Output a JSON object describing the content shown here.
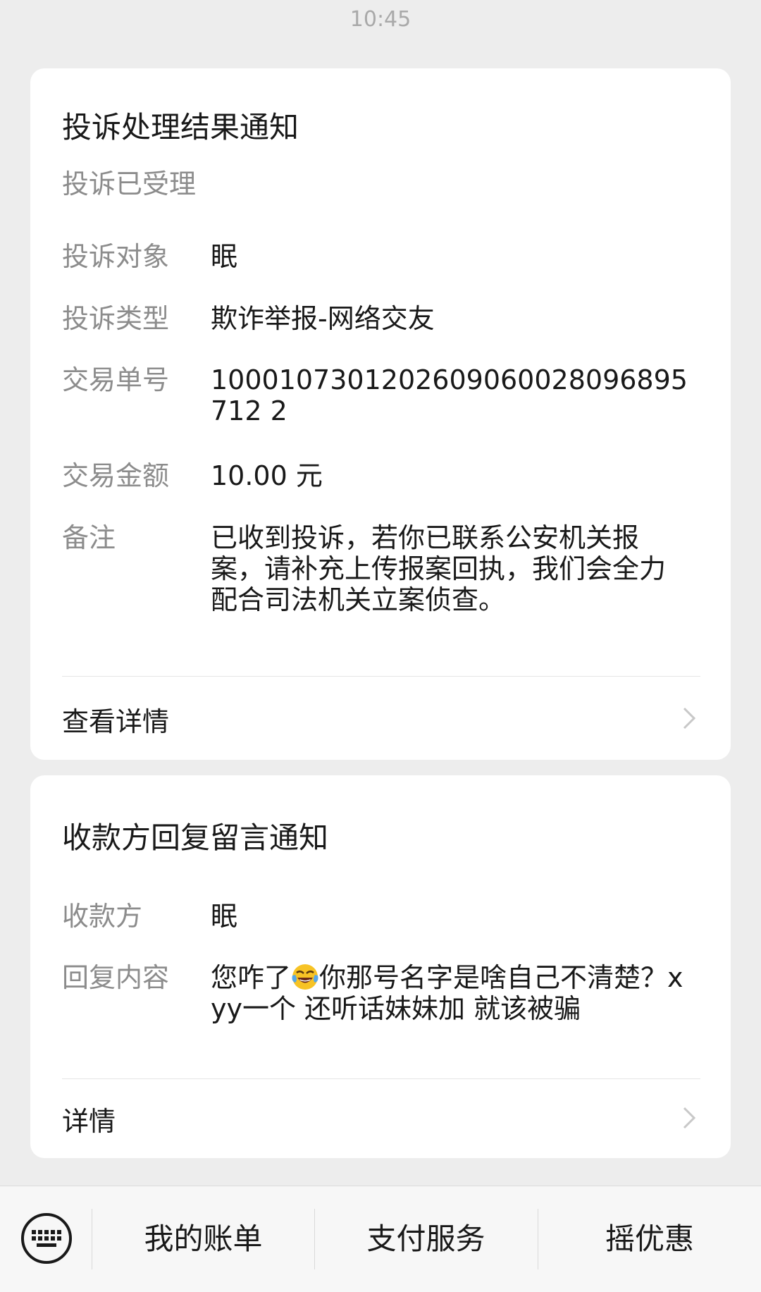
{
  "timestamp": "10:45",
  "complaint_card": {
    "title": "投诉处理结果通知",
    "subtitle": "投诉已受理",
    "rows": [
      {
        "label": "投诉对象",
        "value": "眠"
      },
      {
        "label": "投诉类型",
        "value": "欺诈举报-网络交友"
      },
      {
        "label": "交易单号",
        "value": "1000107301202609060028096895712 2"
      },
      {
        "label": "交易金额",
        "value": "10.00 元"
      },
      {
        "label": "备注",
        "value": "已收到投诉，若你已联系公安机关报案，请补充上传报案回执，我们会全力配合司法机关立案侦查。"
      }
    ],
    "footer_link": "查看详情"
  },
  "reply_card": {
    "title": "收款方回复留言通知",
    "rows": [
      {
        "label": "收款方",
        "value": "眠"
      },
      {
        "label": "回复内容",
        "value_before_emoji": "您咋了",
        "emoji": "face-with-tears-of-joy",
        "value_after_emoji": "你那号名字是啥自己不清楚？xyy一个 还听话妹妹加 就该被骗"
      }
    ],
    "footer_link": "详情"
  },
  "bottom_bar": {
    "items": [
      "我的账单",
      "支付服务",
      "摇优惠"
    ]
  }
}
